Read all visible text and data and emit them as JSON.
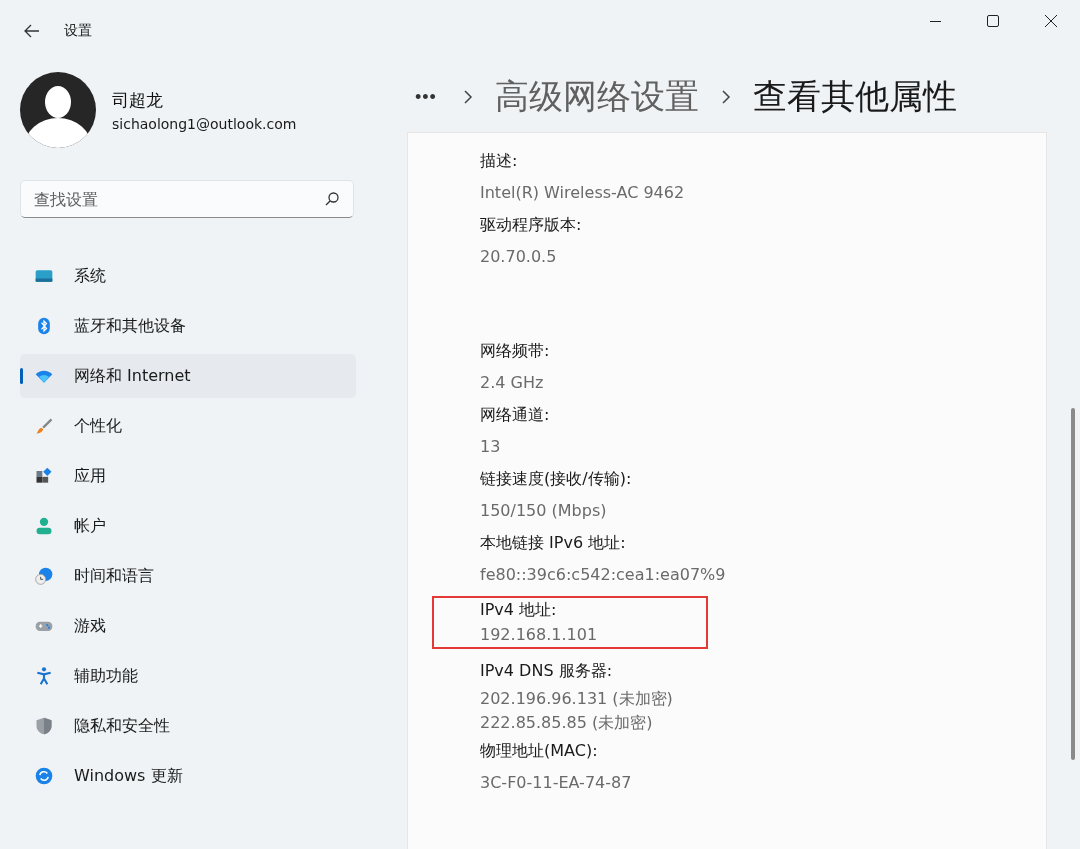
{
  "window": {
    "title": "设置"
  },
  "user": {
    "name": "司超龙",
    "email": "sichaolong1@outlook.com"
  },
  "search": {
    "placeholder": "查找设置"
  },
  "sidebar": {
    "items": [
      {
        "label": "系统",
        "selected": false
      },
      {
        "label": "蓝牙和其他设备",
        "selected": false
      },
      {
        "label": "网络和 Internet",
        "selected": true
      },
      {
        "label": "个性化",
        "selected": false
      },
      {
        "label": "应用",
        "selected": false
      },
      {
        "label": "帐户",
        "selected": false
      },
      {
        "label": "时间和语言",
        "selected": false
      },
      {
        "label": "游戏",
        "selected": false
      },
      {
        "label": "辅助功能",
        "selected": false
      },
      {
        "label": "隐私和安全性",
        "selected": false
      },
      {
        "label": "Windows 更新",
        "selected": false
      }
    ]
  },
  "breadcrumb": {
    "overflow": "•••",
    "items": [
      {
        "label": "高级网络设置",
        "current": false
      },
      {
        "label": "查看其他属性",
        "current": true
      }
    ]
  },
  "properties": {
    "groups": [
      [
        {
          "label": "描述:",
          "values": [
            "Intel(R) Wireless-AC 9462"
          ],
          "highlighted": false
        },
        {
          "label": "驱动程序版本:",
          "values": [
            "20.70.0.5"
          ],
          "highlighted": false
        }
      ],
      [
        {
          "label": "网络频带:",
          "values": [
            "2.4 GHz"
          ],
          "highlighted": false
        },
        {
          "label": "网络通道:",
          "values": [
            "13"
          ],
          "highlighted": false
        },
        {
          "label": "链接速度(接收/传输):",
          "values": [
            "150/150 (Mbps)"
          ],
          "highlighted": false
        },
        {
          "label": "本地链接 IPv6 地址:",
          "values": [
            "fe80::39c6:c542:cea1:ea07%9"
          ],
          "highlighted": false
        },
        {
          "label": "IPv4 地址:",
          "values": [
            "192.168.1.101"
          ],
          "highlighted": true
        },
        {
          "label": "IPv4 DNS 服务器:",
          "values": [
            "202.196.96.131 (未加密)",
            "222.85.85.85 (未加密)"
          ],
          "highlighted": false
        },
        {
          "label": "物理地址(MAC):",
          "values": [
            "3C-F0-11-EA-74-87"
          ],
          "highlighted": false
        }
      ]
    ]
  }
}
